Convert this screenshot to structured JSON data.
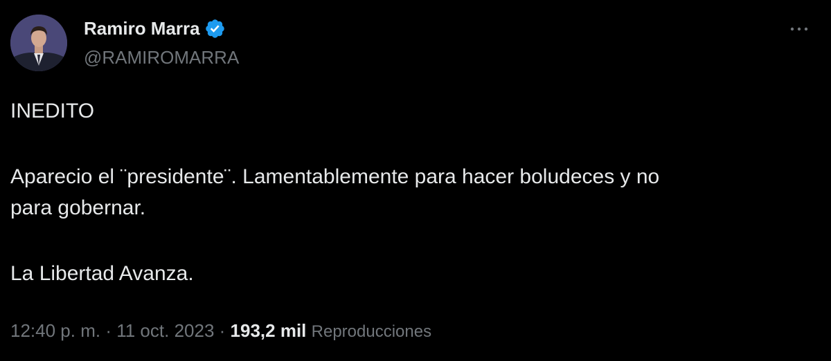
{
  "author": {
    "display_name": "Ramiro Marra",
    "handle": "@RAMIROMARRA",
    "verified": true,
    "avatar_icon": "user-avatar"
  },
  "tweet": {
    "lines": [
      "INEDITO",
      "Aparecio el ¨presidente¨. Lamentablemente para hacer boludeces y no",
      "para gobernar.",
      "La Libertad Avanza."
    ]
  },
  "meta": {
    "time": "12:40 p. m.",
    "separator": "·",
    "date": "11 oct. 2023",
    "views_count": "193,2 mil",
    "views_label": "Reproducciones"
  },
  "colors": {
    "background": "#000000",
    "text_primary": "#e7e9ea",
    "text_secondary": "#71767b",
    "verified_badge": "#1d9bf0"
  },
  "icons": {
    "verified": "verified-badge-icon",
    "more": "more-options-icon"
  }
}
